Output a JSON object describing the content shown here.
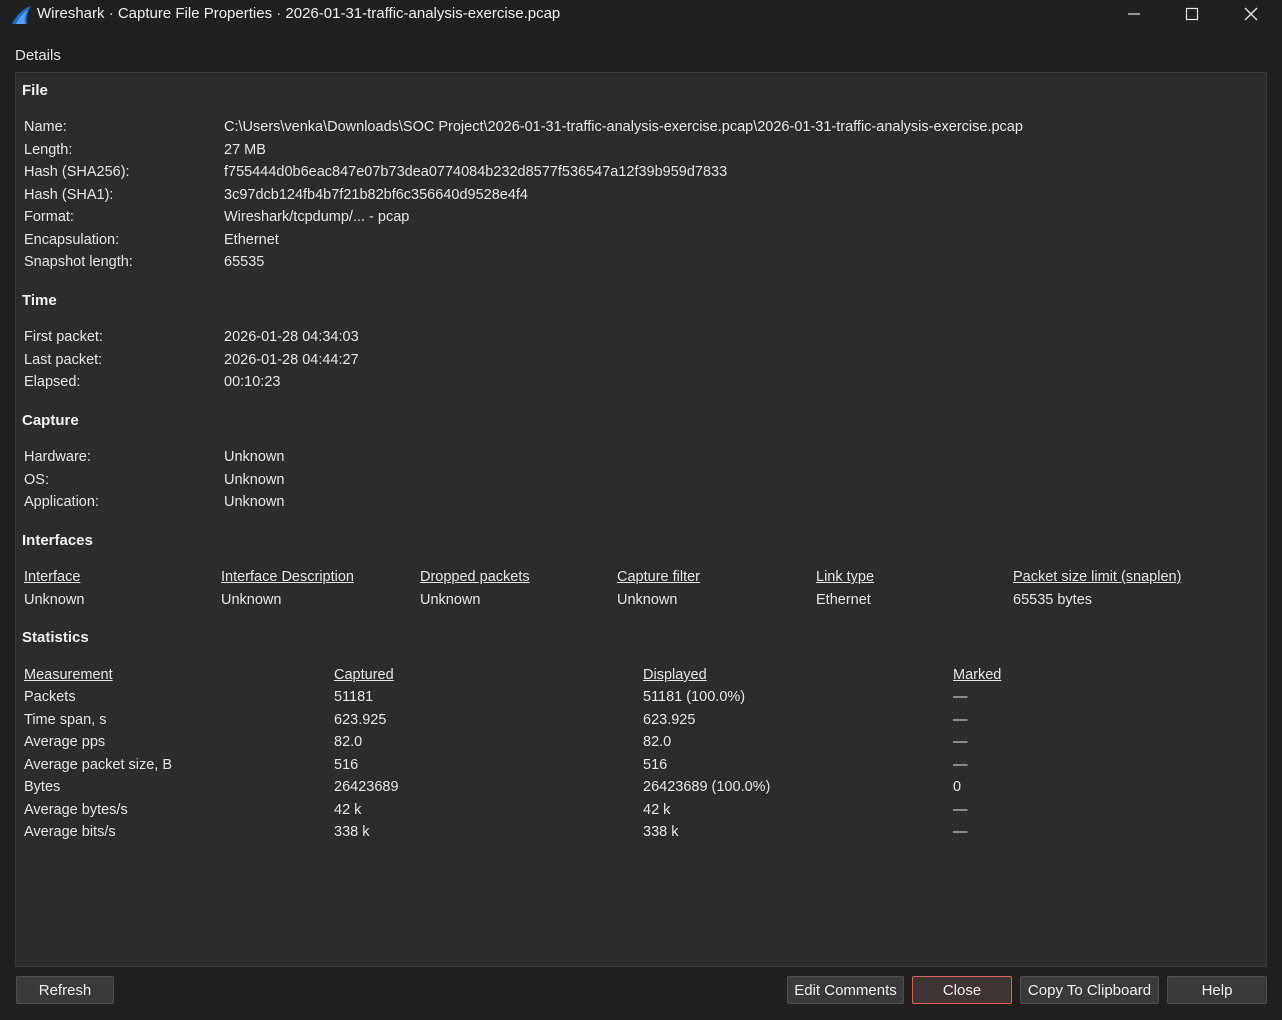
{
  "window": {
    "title": "Wireshark · Capture File Properties · 2026-01-31-traffic-analysis-exercise.pcap"
  },
  "details_label": "Details",
  "file": {
    "heading": "File",
    "rows": [
      {
        "key": "Name:",
        "value": "C:\\Users\\venka\\Downloads\\SOC Project\\2026-01-31-traffic-analysis-exercise.pcap\\2026-01-31-traffic-analysis-exercise.pcap"
      },
      {
        "key": "Length:",
        "value": "27 MB"
      },
      {
        "key": "Hash (SHA256):",
        "value": "f755444d0b6eac847e07b73dea0774084b232d8577f536547a12f39b959d7833"
      },
      {
        "key": "Hash (SHA1):",
        "value": "3c97dcb124fb4b7f21b82bf6c356640d9528e4f4"
      },
      {
        "key": "Format:",
        "value": "Wireshark/tcpdump/... - pcap"
      },
      {
        "key": "Encapsulation:",
        "value": "Ethernet"
      },
      {
        "key": "Snapshot length:",
        "value": "65535"
      }
    ]
  },
  "time": {
    "heading": "Time",
    "rows": [
      {
        "key": "First packet:",
        "value": "2026-01-28 04:34:03"
      },
      {
        "key": "Last packet:",
        "value": "2026-01-28 04:44:27"
      },
      {
        "key": "Elapsed:",
        "value": "00:10:23"
      }
    ]
  },
  "capture": {
    "heading": "Capture",
    "rows": [
      {
        "key": "Hardware:",
        "value": "Unknown"
      },
      {
        "key": "OS:",
        "value": "Unknown"
      },
      {
        "key": "Application:",
        "value": "Unknown"
      }
    ]
  },
  "interfaces": {
    "heading": "Interfaces",
    "columns": [
      "Interface",
      "Interface Description",
      "Dropped packets",
      "Capture filter",
      "Link type",
      "Packet size limit (snaplen)"
    ],
    "row": [
      "Unknown",
      "Unknown",
      "Unknown",
      "Unknown",
      "Ethernet",
      "65535 bytes"
    ]
  },
  "statistics": {
    "heading": "Statistics",
    "columns": [
      "Measurement",
      "Captured",
      "Displayed",
      "Marked"
    ],
    "rows": [
      [
        "Packets",
        "51181",
        "51181 (100.0%)",
        "—"
      ],
      [
        "Time span, s",
        "623.925",
        "623.925",
        "—"
      ],
      [
        "Average pps",
        "82.0",
        "82.0",
        "—"
      ],
      [
        "Average packet size, B",
        "516",
        "516",
        "—"
      ],
      [
        "Bytes",
        "26423689",
        "26423689 (100.0%)",
        "0"
      ],
      [
        "Average bytes/s",
        "42 k",
        "42 k",
        "—"
      ],
      [
        "Average bits/s",
        "338 k",
        "338 k",
        "—"
      ]
    ]
  },
  "buttons": {
    "refresh": "Refresh",
    "edit_comments": "Edit Comments",
    "close": "Close",
    "copy": "Copy To Clipboard",
    "help": "Help"
  },
  "icons": {
    "app": "wireshark-fin-icon",
    "minimize": "minimize-icon",
    "maximize": "maximize-icon",
    "close": "close-icon"
  },
  "colors": {
    "background": "#202020",
    "panel": "#2c2c2c",
    "close_button_border": "#d9605a",
    "wireshark_blue": "#1a6fd1"
  }
}
